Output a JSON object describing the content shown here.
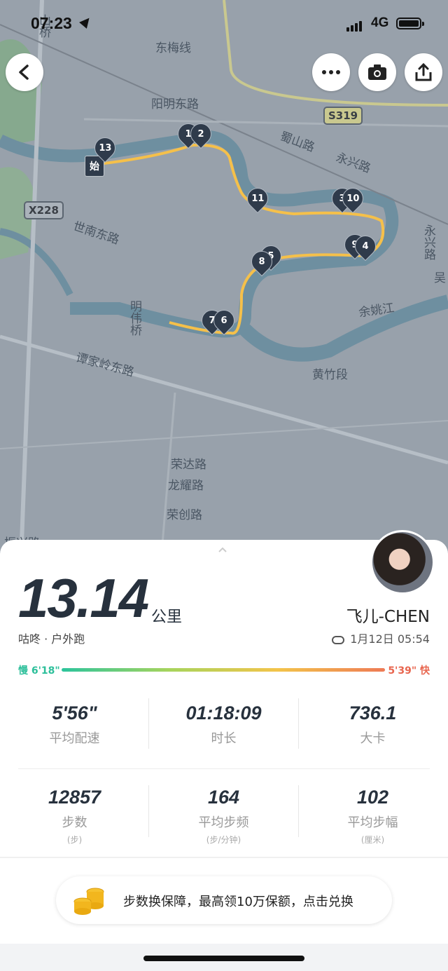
{
  "status": {
    "time": "07:23",
    "network": "4G"
  },
  "map": {
    "labels": {
      "road1": "东梅线",
      "road2": "阳明东路",
      "road3": "蜀山路",
      "road4": "永兴路",
      "road5": "世南东路",
      "road6": "明伟桥",
      "road7": "谭家岭东路",
      "river": "余姚江",
      "area1": "黄竹段",
      "road8": "荣达路",
      "road9": "龙耀路",
      "road10": "荣创路",
      "road11": "山桥",
      "road12": "永兴路",
      "road13": "吴",
      "road14": "振兴路"
    },
    "road_tags": {
      "s319": "S319",
      "x228": "X228"
    },
    "start_label": "始",
    "pins": [
      "1",
      "2",
      "3",
      "4",
      "5",
      "6",
      "7",
      "8",
      "9",
      "10",
      "11",
      "13"
    ]
  },
  "icons": {
    "back": "chevron-left-icon",
    "more": "more-icon",
    "camera": "camera-icon",
    "share": "share-icon"
  },
  "summary": {
    "distance": "13.14",
    "unit": "公里",
    "source": "咕咚 · 户外跑",
    "username": "飞儿-CHEN",
    "date": "1月12日 05:54",
    "pace_slow": "慢 6'18\"",
    "pace_fast": "5'39\" 快"
  },
  "stats": [
    {
      "value": "5'56\"",
      "label": "平均配速",
      "unit": ""
    },
    {
      "value": "01:18:09",
      "label": "时长",
      "unit": ""
    },
    {
      "value": "736.1",
      "label": "大卡",
      "unit": ""
    },
    {
      "value": "12857",
      "label": "步数",
      "unit": "(步)"
    },
    {
      "value": "164",
      "label": "平均步频",
      "unit": "(步/分钟)"
    },
    {
      "value": "102",
      "label": "平均步幅",
      "unit": "(厘米)"
    }
  ],
  "promo": {
    "text": "步数换保障，最高领10万保额，点击兑换"
  },
  "colors": {
    "route": "#f5c04a",
    "pace_slow": "#2cbf9a",
    "pace_fast": "#e8664f",
    "pin": "#2f3b4b"
  }
}
